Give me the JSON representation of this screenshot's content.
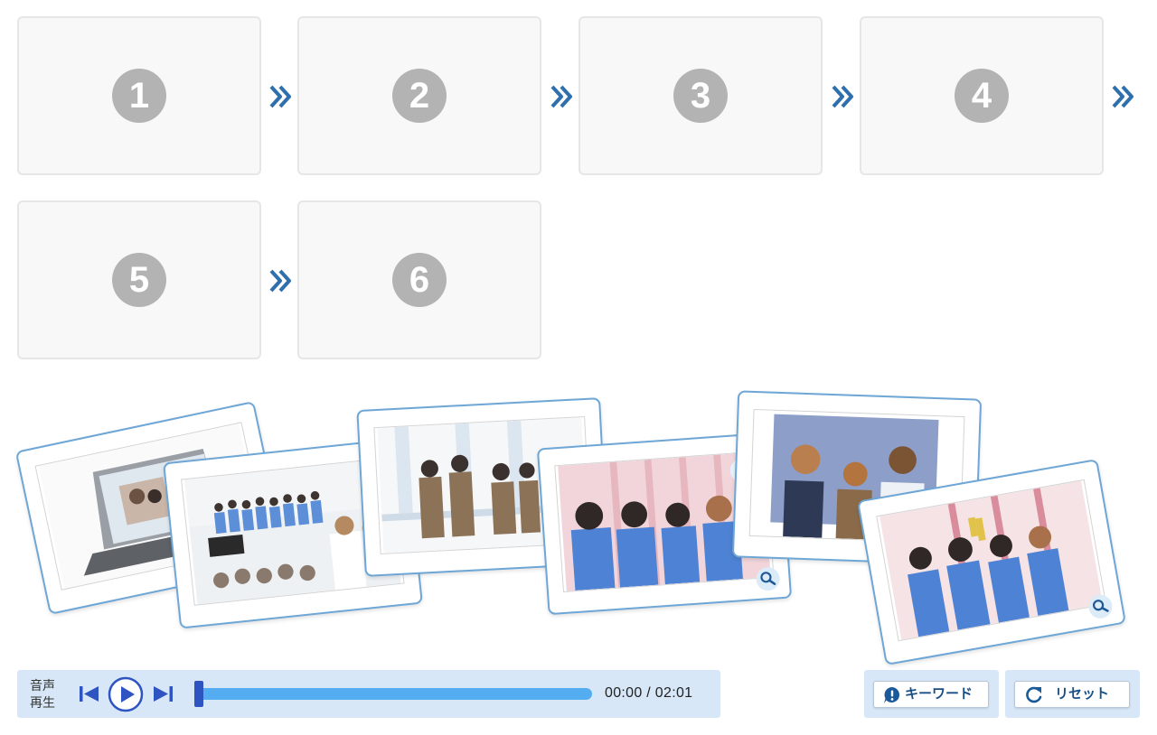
{
  "slots": [
    {
      "number": "1"
    },
    {
      "number": "2"
    },
    {
      "number": "3"
    },
    {
      "number": "4"
    },
    {
      "number": "5"
    },
    {
      "number": "6"
    }
  ],
  "icons": {
    "arrow": "double-chevron-right-icon",
    "zoom": "magnifier-icon",
    "skip_prev": "skip-previous-icon",
    "play": "play-icon",
    "skip_next": "skip-next-icon",
    "keyword": "exclamation-bubble-icon",
    "reset": "reset-arrow-icon"
  },
  "player": {
    "label": "音声再生",
    "current_time": "00:00",
    "separator": " / ",
    "duration": "02:01",
    "progress": 0
  },
  "buttons": {
    "keyword": "キーワード",
    "reset": "リセット"
  },
  "colors": {
    "accent": "#2e6fae",
    "card_border": "#6ea6d6",
    "panel_bg": "#d7e7f7",
    "track": "#53adf0",
    "thumb": "#2e54c2"
  }
}
